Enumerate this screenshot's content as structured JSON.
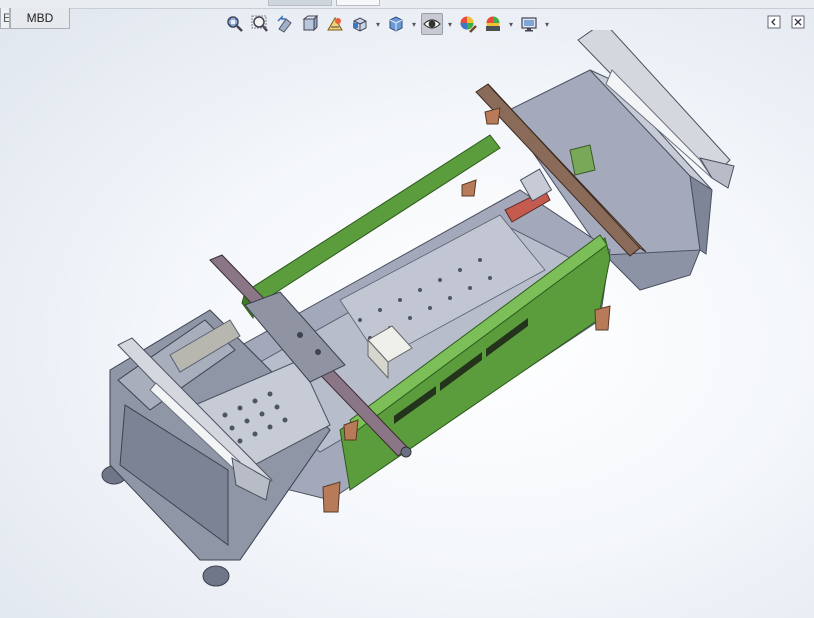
{
  "document_tabs": [
    {
      "label": "E",
      "cut": true
    },
    {
      "label": "MBD",
      "cut": false
    }
  ],
  "heads_up_toolbar": [
    {
      "name": "zoom-to-fit-icon"
    },
    {
      "name": "zoom-to-area-icon"
    },
    {
      "name": "previous-view-icon"
    },
    {
      "name": "section-view-icon"
    },
    {
      "name": "dynamic-annotation-views-icon"
    },
    {
      "name": "view-orientation-icon",
      "dropdown": true
    },
    {
      "name": "display-style-icon",
      "dropdown": true
    },
    {
      "name": "hide-show-items-icon",
      "dropdown": true,
      "pressed": true
    },
    {
      "name": "edit-appearance-icon"
    },
    {
      "name": "apply-scene-icon",
      "dropdown": true
    },
    {
      "name": "view-settings-icon",
      "dropdown": true
    }
  ],
  "window_controls": [
    {
      "name": "restore-window-icon"
    },
    {
      "name": "close-window-icon"
    }
  ],
  "colors": {
    "frame_grey": "#8f96a6",
    "frame_dark": "#5f6676",
    "panel_green": "#5b9c3c",
    "panel_green_dark": "#3f7a2a",
    "rail_brown": "#8a6a58",
    "bracket_orange": "#b77b5a",
    "plate_light": "#c9ccd6"
  }
}
